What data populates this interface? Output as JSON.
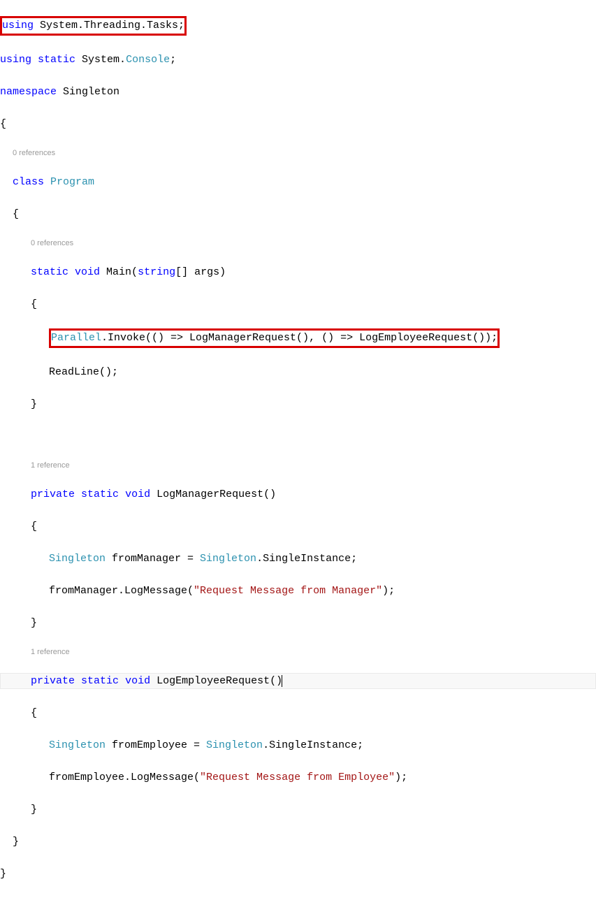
{
  "code": {
    "using_tasks_kw1": "using",
    "using_tasks_ns": " System.Threading.Tasks;",
    "using_static_kw1": "using",
    "using_static_kw2": "static",
    "using_static_ns1": " System.",
    "using_static_type": "Console",
    "using_static_end": ";",
    "namespace_kw": "namespace",
    "namespace_name": " Singleton",
    "ref0": "0 references",
    "class_kw": "class",
    "class_name": "Program",
    "ref_main": "0 references",
    "static_kw": "static",
    "void_kw": "void",
    "main_name": " Main(",
    "string_kw": "string",
    "main_args": "[] args)",
    "parallel_type": "Parallel",
    "parallel_rest": ".Invoke(() => LogManagerRequest(), () => LogEmployeeRequest());",
    "readline": "ReadLine();",
    "ref_mgr": "1 reference",
    "private_kw": "private",
    "logmgr_name": " LogManagerRequest()",
    "singleton_type": "Singleton",
    "frommgr_decl": " fromManager = ",
    "frommgr_end": ".SingleInstance;",
    "frommgr_call1": "fromManager.LogMessage(",
    "frommgr_str": "\"Request Message from Manager\"",
    "frommgr_call2": ");",
    "ref_emp": "1 reference",
    "logemp_name": " LogEmployeeRequest()",
    "fromemp_decl": " fromEmployee = ",
    "fromemp_end": ".SingleInstance;",
    "fromemp_call1": "fromEmployee.LogMessage(",
    "fromemp_str": "\"Request Message from Employee\"",
    "fromemp_call2": ");",
    "brace_open": "{",
    "brace_close": "}"
  }
}
